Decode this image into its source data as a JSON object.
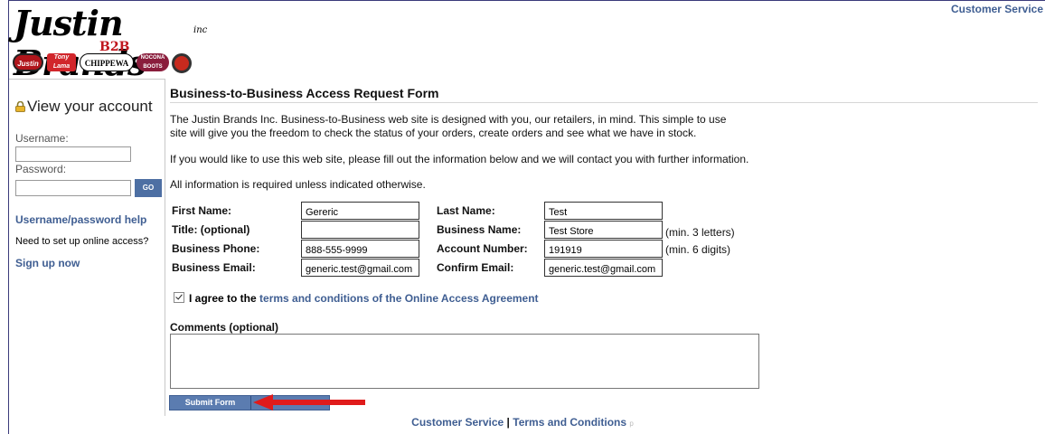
{
  "logo": {
    "main": "Justin Brands",
    "inc": "inc",
    "b2b": "B2B",
    "brands": [
      "Justin",
      "Tony Lama",
      "CHIPPEWA",
      "NOCONA BOOTS",
      ""
    ]
  },
  "header": {
    "customer_service": "Customer Service"
  },
  "sidebar": {
    "title": "View your account",
    "username_label": "Username:",
    "username_value": "",
    "password_label": "Password:",
    "password_value": "",
    "go_label": "GO",
    "help_link": "Username/password help",
    "need_text": "Need to set up online access?",
    "signup_link": "Sign up now"
  },
  "main": {
    "title": "Business-to-Business Access Request Form",
    "para1_line1": "The Justin Brands Inc. Business-to-Business web site is designed with you, our retailers, in mind. This simple to use",
    "para1_line2": "site will give you the freedom to check the status of your orders, create orders and see what we have in stock.",
    "para2": "If you would like to use this web site, please fill out the information below and we will contact you with further information.",
    "para3": "All information is required unless indicated otherwise."
  },
  "form": {
    "first_name": {
      "label": "First Name:",
      "value": "Gereric"
    },
    "title": {
      "label": "Title: (optional)",
      "value": ""
    },
    "business_phone": {
      "label": "Business Phone:",
      "value": "888-555-9999"
    },
    "business_email": {
      "label": "Business Email:",
      "value": "generic.test@gmail.com"
    },
    "last_name": {
      "label": "Last Name:",
      "value": "Test"
    },
    "business_name": {
      "label": "Business Name:",
      "value": "Test Store",
      "note": "(min. 3 letters)"
    },
    "account_number": {
      "label": "Account Number:",
      "value": "191919",
      "note": "(min. 6 digits)"
    },
    "confirm_email": {
      "label": "Confirm Email:",
      "value": "generic.test@gmail.com"
    },
    "agree_prefix": "I agree to the",
    "agree_link": "terms and conditions of the Online Access Agreement",
    "agree_checked": true,
    "comments_label": "Comments (optional)",
    "comments_value": "",
    "submit_label": "Submit Form"
  },
  "footer": {
    "customer_service": "Customer Service",
    "separator": "|",
    "terms": "Terms and Conditions",
    "tiny": "p"
  },
  "colors": {
    "link": "#3f5e92",
    "button": "#5b7cb0",
    "arrow": "#e01b1b"
  }
}
